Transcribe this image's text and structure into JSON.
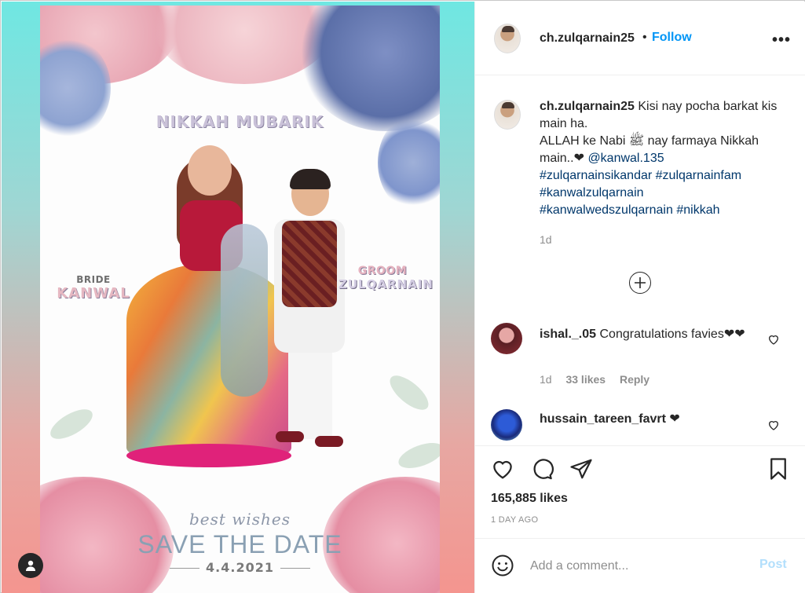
{
  "post_image": {
    "headline": "NIKKAH MUBARIK",
    "bride_small": "BRIDE",
    "bride_name": "KANWAL",
    "groom_small": "GROOM",
    "groom_name": "ZULQARNAIN",
    "best_wishes": "best wishes",
    "save_the_date": "SAVE THE DATE",
    "date": "4.4.2021",
    "user_tag_icon": "user-icon"
  },
  "header": {
    "username": "ch.zulqarnain25",
    "separator": "•",
    "follow_label": "Follow",
    "more_label": "•••"
  },
  "caption": {
    "username": "ch.zulqarnain25",
    "line1": "Kisi nay pocha barkat kis main ha.",
    "line2": "ALLAH ke Nabi ﷺ nay farmaya Nikkah main..❤",
    "mention": "@kanwal.135",
    "hashtags": [
      "#zulqarnainsikandar",
      "#zulqarnainfam",
      "#kanwalzulqarnain",
      "#kanwalwedszulqarnain",
      "#nikkah"
    ],
    "time": "1d",
    "load_more_icon": "plus-circle-icon"
  },
  "comments": [
    {
      "username": "ishal._.05",
      "text": "Congratulations favies❤❤",
      "time": "1d",
      "likes": "33 likes",
      "reply": "Reply"
    },
    {
      "username": "hussain_tareen_favrt",
      "text": "❤"
    }
  ],
  "actions": {
    "likes_total": "165,885 likes",
    "posted_ago": "1 DAY AGO"
  },
  "add_comment": {
    "placeholder": "Add a comment...",
    "post_label": "Post"
  },
  "colors": {
    "accent": "#0095f6",
    "link": "#00376b",
    "muted": "#8e8e8e",
    "post_disabled": "#b2dffc"
  }
}
